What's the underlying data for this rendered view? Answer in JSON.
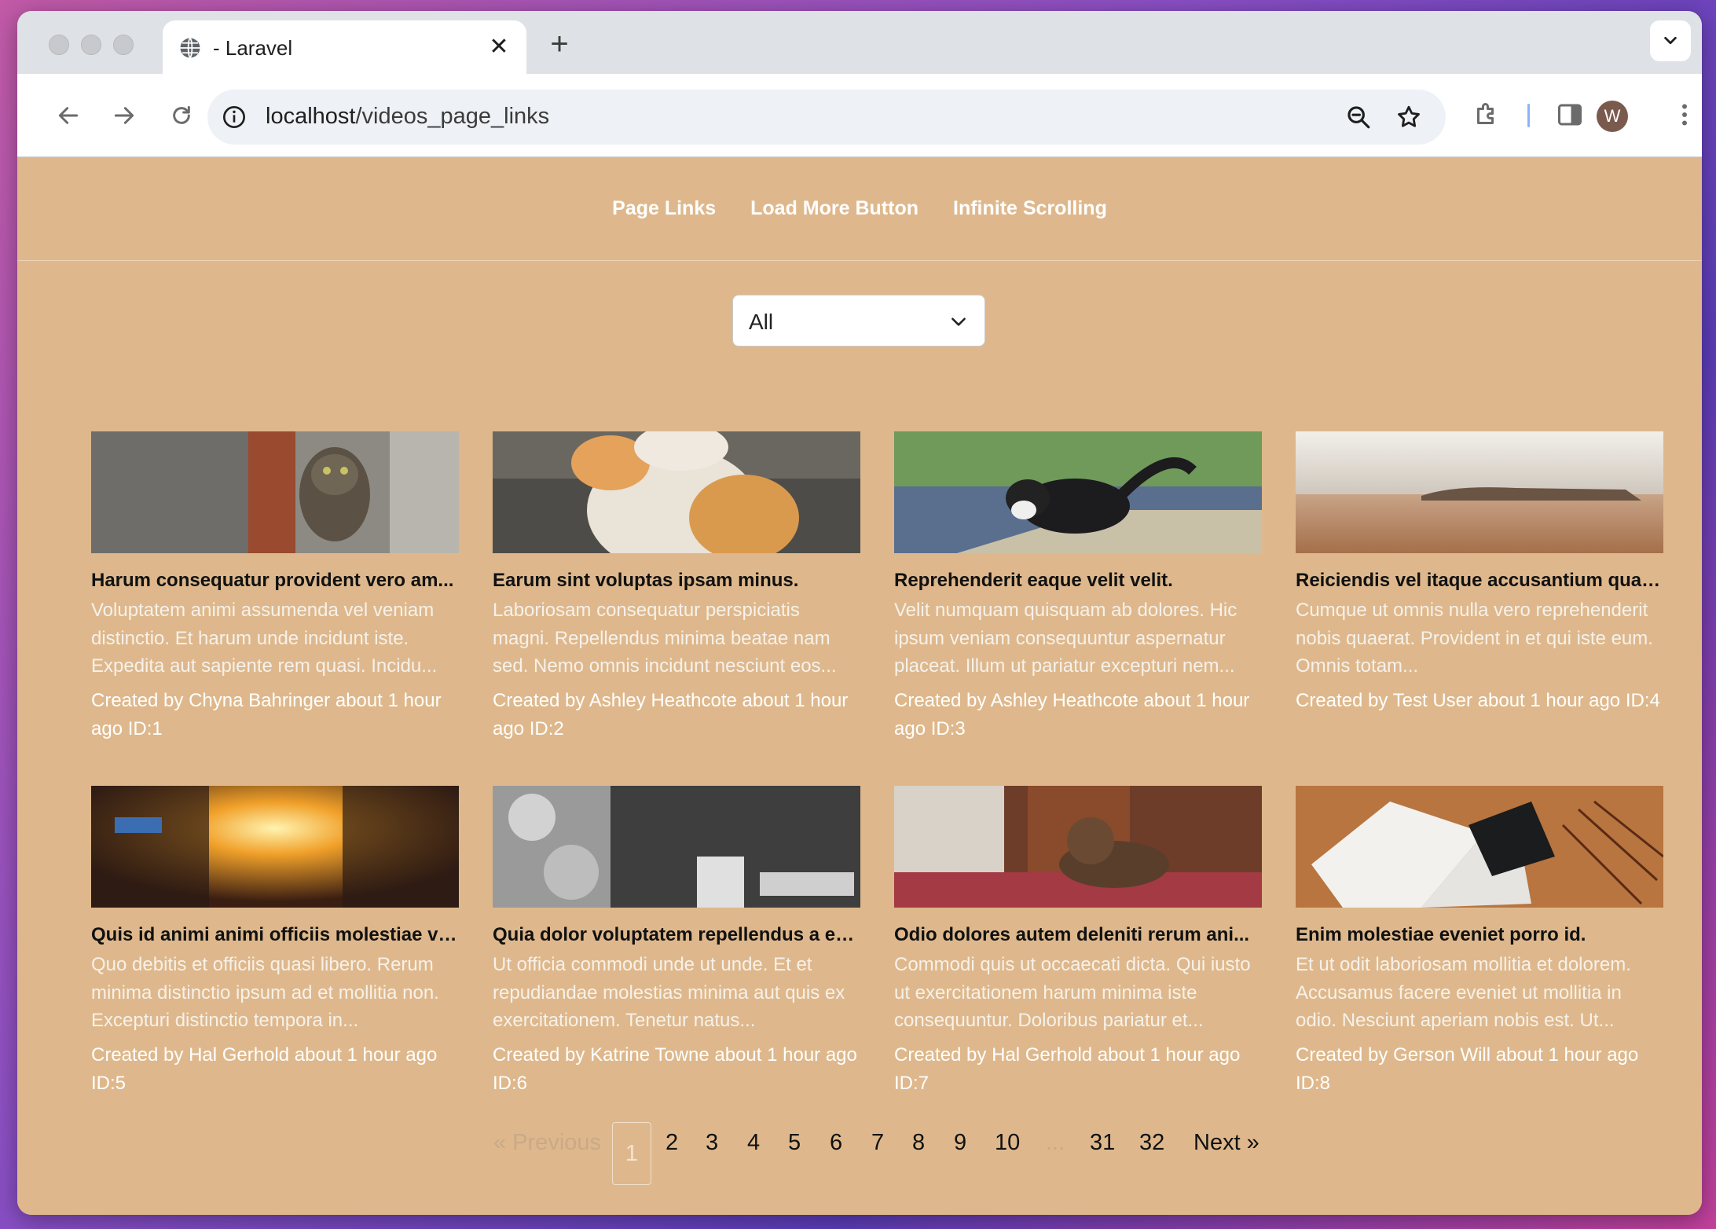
{
  "browser": {
    "tab_title": "- Laravel",
    "url_host": "localhost",
    "url_path": "/videos_page_links",
    "avatar_letter": "W"
  },
  "nav": {
    "links": [
      "Page Links",
      "Load More Button",
      "Infinite Scrolling"
    ]
  },
  "filter": {
    "selected": "All"
  },
  "cards": [
    {
      "title": "Harum consequatur provident vero am...",
      "desc": "Voluptatem animi assumenda vel veniam distinctio. Et harum unde incidunt iste. Expedita aut sapiente rem quasi. Incidu...",
      "meta": "Created by Chyna Bahringer about 1 hour ago ID:1",
      "image": "cat-in-doorway"
    },
    {
      "title": "Earum sint voluptas ipsam minus.",
      "desc": "Laboriosam consequatur perspiciatis magni. Repellendus minima beatae nam sed. Nemo omnis incidunt nesciunt eos...",
      "meta": "Created by Ashley Heathcote about 1 hour ago ID:2",
      "image": "orange-white-cat"
    },
    {
      "title": "Reprehenderit eaque velit velit.",
      "desc": "Velit numquam quisquam ab dolores. Hic ipsum veniam consequuntur aspernatur placeat. Illum ut pariatur excepturi nem...",
      "meta": "Created by Ashley Heathcote about 1 hour ago ID:3",
      "image": "black-white-cat"
    },
    {
      "title": "Reiciendis vel itaque accusantium quas ...",
      "desc": "Cumque ut omnis nulla vero reprehenderit nobis quaerat. Provident in et qui iste eum. Omnis totam...",
      "meta": "Created by Test User about 1 hour ago ID:4",
      "image": "beach-landscape"
    },
    {
      "title": "Quis id animi animi officiis molestiae vo...",
      "desc": "Quo debitis et officiis quasi libero. Rerum minima distinctio ipsum ad et mollitia non. Excepturi distinctio tempora in...",
      "meta": "Created by Hal Gerhold about 1 hour ago ID:5",
      "image": "street-sunset"
    },
    {
      "title": "Quia dolor voluptatem repellendus a ex...",
      "desc": "Ut officia commodi unde ut unde. Et et repudiandae molestias minima aut quis ex exercitationem. Tenetur natus...",
      "meta": "Created by Katrine Towne about 1 hour ago ID:6",
      "image": "monochrome-christmas"
    },
    {
      "title": "Odio dolores autem deleniti rerum ani...",
      "desc": "Commodi quis ut occaecati dicta. Qui iusto ut exercitationem harum minima iste consequuntur. Doloribus pariatur et...",
      "meta": "Created by Hal Gerhold about 1 hour ago ID:7",
      "image": "cat-on-bed"
    },
    {
      "title": "Enim molestiae eveniet porro id.",
      "desc": "Et ut odit laboriosam mollitia et dolorem. Accusamus facere eveniet ut mollitia in odio. Nesciunt aperiam nobis est. Ut...",
      "meta": "Created by Gerson Will about 1 hour ago ID:8",
      "image": "open-magazine"
    }
  ],
  "pagination": {
    "previous": "« Previous",
    "next": "Next »",
    "current": "1",
    "pages": [
      "1",
      "2",
      "3",
      "4",
      "5",
      "6",
      "7",
      "8",
      "9",
      "10",
      "...",
      "31",
      "32"
    ]
  },
  "colors": {
    "page_bg": "#deb88c",
    "nav_text": "#ffffff",
    "desc_text": "#f6f1ea"
  }
}
